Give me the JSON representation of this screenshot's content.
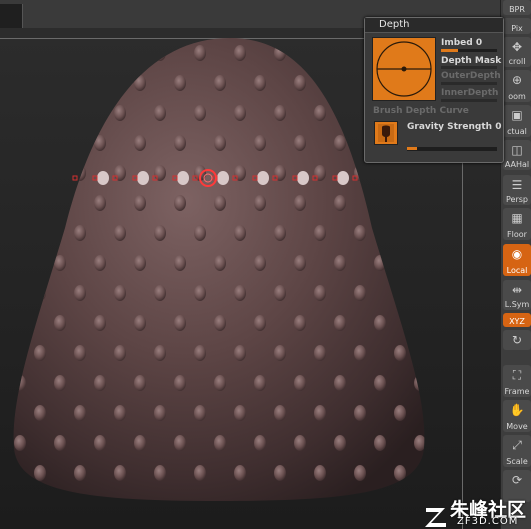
{
  "depth_palette": {
    "title": "Depth",
    "imbed_label": "Imbed",
    "imbed_value": "0",
    "imbed_level": 0.3,
    "depth_mask_label": "Depth Mask",
    "outer_depth_label": "OuterDepth",
    "inner_depth_label": "InnerDepth",
    "brush_depth_curve_label": "Brush Depth Curve",
    "gravity_strength_label": "Gravity Strength",
    "gravity_strength_value": "0",
    "accent_color": "#e07a1a"
  },
  "right_shelf": {
    "items": [
      {
        "label": "BPR",
        "icon": "bpr-icon"
      },
      {
        "label": "Pix",
        "icon": "pixol-icon"
      },
      {
        "label": "croll",
        "icon": "scroll-icon"
      },
      {
        "label": "oom",
        "icon": "zoom-icon"
      },
      {
        "label": "ctual",
        "icon": "actual-icon"
      },
      {
        "label": "AAHal",
        "icon": "aahalf-icon"
      },
      {
        "label": "Persp",
        "icon": "perspective-icon"
      },
      {
        "label": "Floor",
        "icon": "floor-icon"
      },
      {
        "label": "Local",
        "icon": "local-icon"
      },
      {
        "label": "L.Sym",
        "icon": "lsym-icon"
      },
      {
        "label": "XYZ",
        "icon": "xyz-icon"
      },
      {
        "label": "Frame",
        "icon": "frame-icon"
      },
      {
        "label": "Move",
        "icon": "move-icon"
      },
      {
        "label": "Scale",
        "icon": "scale-icon"
      }
    ]
  },
  "watermark": {
    "title": "朱峰社区",
    "site": "ZF3D.COM"
  }
}
